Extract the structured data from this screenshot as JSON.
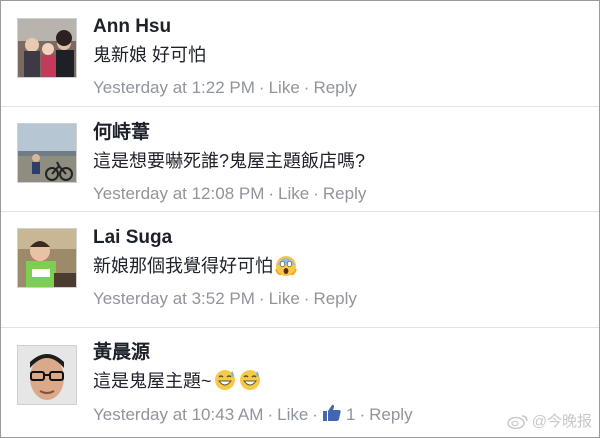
{
  "comments": [
    {
      "author": "Ann Hsu",
      "text": "鬼新娘 好可怕",
      "time": "Yesterday at 1:22 PM",
      "like": "Like",
      "reply": "Reply"
    },
    {
      "author": "何峙葦",
      "text": "這是想要嚇死誰?鬼屋主題飯店嗎?",
      "time": "Yesterday at 12:08 PM",
      "like": "Like",
      "reply": "Reply"
    },
    {
      "author": "Lai Suga",
      "text": "新娘那個我覺得好可怕",
      "emoji": "screaming-face-emoji",
      "time": "Yesterday at 3:52 PM",
      "like": "Like",
      "reply": "Reply"
    },
    {
      "author": "黃晨源",
      "text": "這是鬼屋主題~",
      "emoji": "grinning-sweat-emoji",
      "time": "Yesterday at 10:43 AM",
      "like": "Like",
      "like_count": "1",
      "reply": "Reply"
    }
  ],
  "watermark": "@今晚报",
  "colors": {
    "text": "#1d2129",
    "meta": "#90949c",
    "like_icon": "#4267b2",
    "divider": "#e3e3e6"
  }
}
